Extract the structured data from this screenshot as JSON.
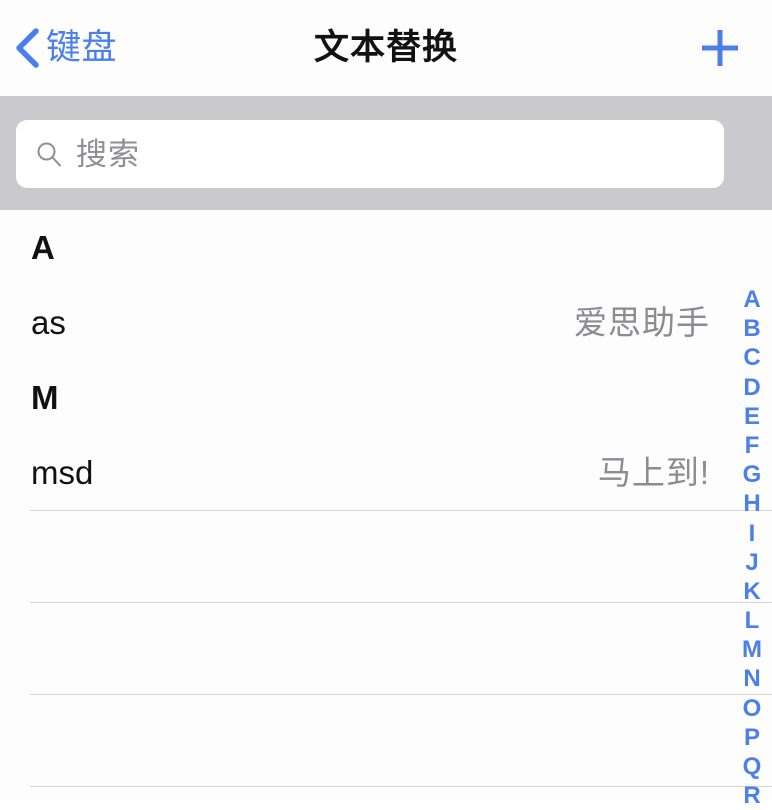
{
  "navbar": {
    "back_label": "键盘",
    "back_icon": "chevron-left-icon",
    "title": "文本替换",
    "add_icon": "plus-icon",
    "accent_color": "#4a7fec"
  },
  "search": {
    "icon": "search-icon",
    "placeholder": "搜索",
    "value": "",
    "background_color": "#c9c9ce"
  },
  "list": {
    "sections": [
      {
        "header": "A",
        "rows": [
          {
            "shortcut": "as",
            "phrase": "爱思助手"
          }
        ]
      },
      {
        "header": "M",
        "rows": [
          {
            "shortcut": "msd",
            "phrase": "马上到!"
          }
        ]
      }
    ],
    "empty_rows": 3,
    "divider_color": "#d6d6d8"
  },
  "index_strip": {
    "letters": [
      "A",
      "B",
      "C",
      "D",
      "E",
      "F",
      "G",
      "H",
      "I",
      "J",
      "K",
      "L",
      "M",
      "N",
      "O",
      "P",
      "Q",
      "R"
    ],
    "color": "#4a7fec"
  }
}
